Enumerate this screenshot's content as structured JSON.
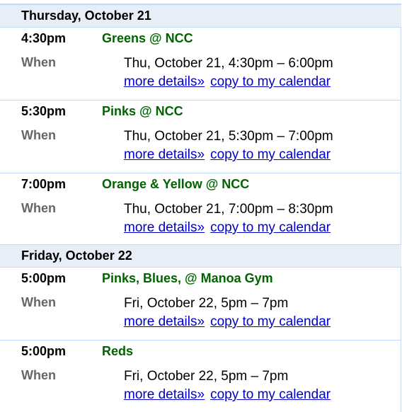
{
  "days": [
    {
      "header": "Thursday, October 21",
      "events": [
        {
          "time": "4:30pm",
          "title": "Greens @ NCC",
          "when_label": "When",
          "when": "Thu, October 21, 4:30pm – 6:00pm",
          "details_link": "more details»",
          "copy_link": "copy to my calendar"
        },
        {
          "time": "5:30pm",
          "title": "Pinks @ NCC",
          "when_label": "When",
          "when": "Thu, October 21, 5:30pm – 7:00pm",
          "details_link": "more details»",
          "copy_link": "copy to my calendar"
        },
        {
          "time": "7:00pm",
          "title": "Orange & Yellow @ NCC",
          "when_label": "When",
          "when": "Thu, October 21, 7:00pm – 8:30pm",
          "details_link": "more details»",
          "copy_link": "copy to my calendar"
        }
      ]
    },
    {
      "header": "Friday, October 22",
      "events": [
        {
          "time": "5:00pm",
          "title": "Pinks, Blues, @ Manoa Gym",
          "when_label": "When",
          "when": "Fri, October 22, 5pm – 7pm",
          "details_link": "more details»",
          "copy_link": "copy to my calendar"
        },
        {
          "time": "5:00pm",
          "title": "Reds",
          "when_label": "When",
          "when": "Fri, October 22, 5pm – 7pm",
          "details_link": "more details»",
          "copy_link": "copy to my calendar"
        }
      ]
    }
  ],
  "colors": {
    "header_bg": "#e8eef7",
    "border": "#c3d9ff",
    "title": "#006300",
    "label": "#666666",
    "link": "#0000cc"
  }
}
